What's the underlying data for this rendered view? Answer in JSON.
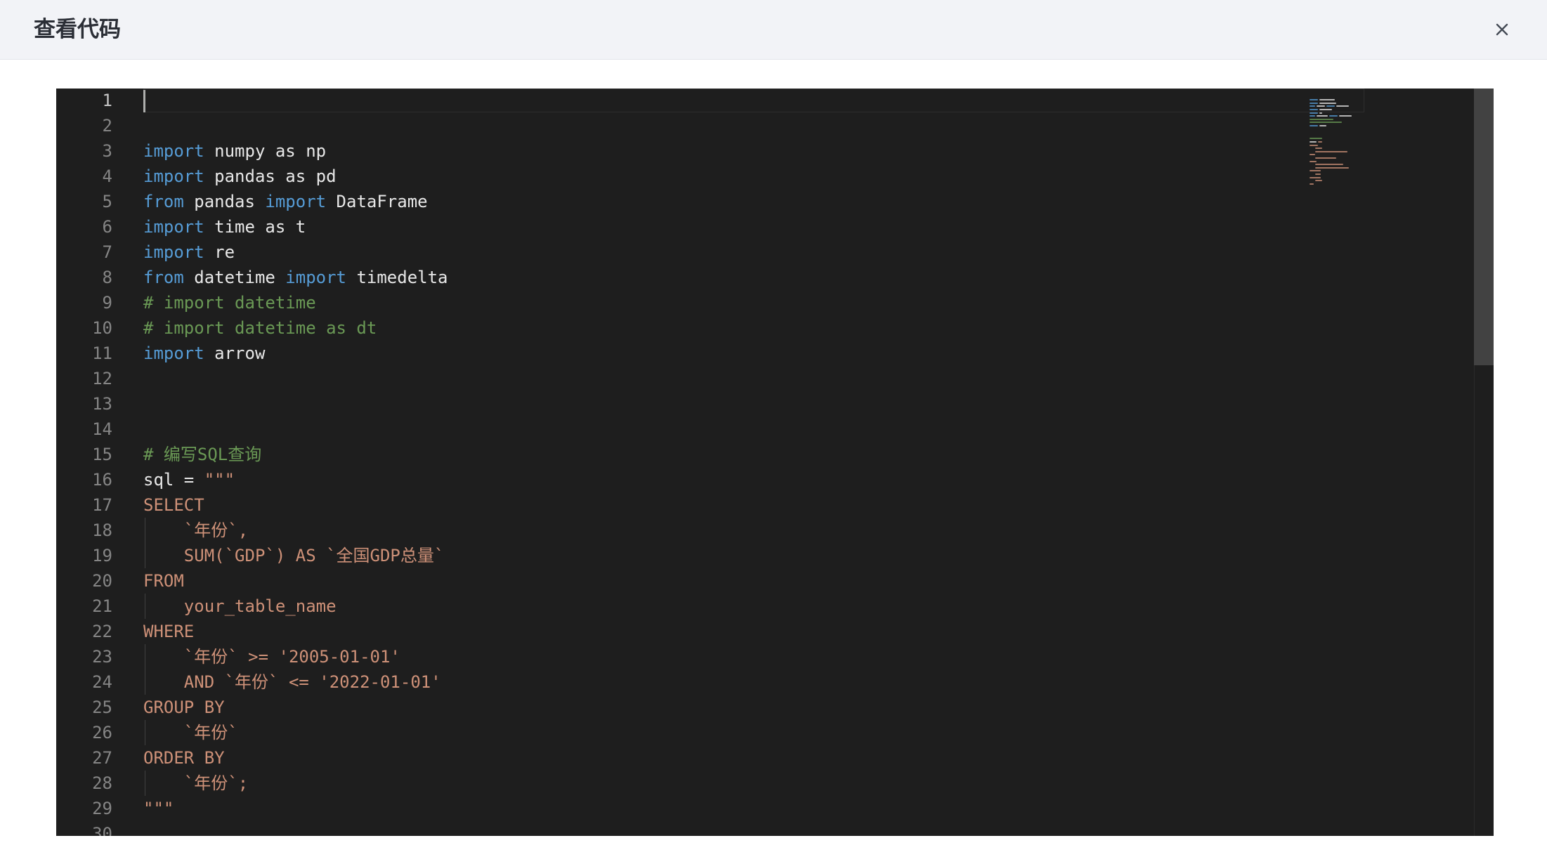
{
  "dialog": {
    "title": "查看代码",
    "close_icon": "close-icon"
  },
  "editor": {
    "line_numbers": [
      "1",
      "2",
      "3",
      "4",
      "5",
      "6",
      "7",
      "8",
      "9",
      "10",
      "11",
      "12",
      "13",
      "14",
      "15",
      "16",
      "17",
      "18",
      "19",
      "20",
      "21",
      "22",
      "23",
      "24",
      "25",
      "26",
      "27",
      "28",
      "29",
      "30"
    ],
    "active_line": 1,
    "lines": [
      [],
      [],
      [
        [
          "kw",
          "import"
        ],
        [
          "id",
          " numpy as np"
        ]
      ],
      [
        [
          "kw",
          "import"
        ],
        [
          "id",
          " pandas as pd"
        ]
      ],
      [
        [
          "kw",
          "from"
        ],
        [
          "id",
          " pandas "
        ],
        [
          "kw",
          "import"
        ],
        [
          "id",
          " DataFrame"
        ]
      ],
      [
        [
          "kw",
          "import"
        ],
        [
          "id",
          " time as t"
        ]
      ],
      [
        [
          "kw",
          "import"
        ],
        [
          "id",
          " re"
        ]
      ],
      [
        [
          "kw",
          "from"
        ],
        [
          "id",
          " datetime "
        ],
        [
          "kw",
          "import"
        ],
        [
          "id",
          " timedelta"
        ]
      ],
      [
        [
          "cm",
          "# import datetime"
        ]
      ],
      [
        [
          "cm",
          "# import datetime as dt"
        ]
      ],
      [
        [
          "kw",
          "import"
        ],
        [
          "id",
          " arrow"
        ]
      ],
      [],
      [],
      [],
      [
        [
          "cm",
          "# 编写SQL查询"
        ]
      ],
      [
        [
          "id",
          "sql = "
        ],
        [
          "st",
          "\"\"\""
        ]
      ],
      [
        [
          "st",
          "SELECT"
        ]
      ],
      [
        [
          "st",
          "    `年份`,"
        ]
      ],
      [
        [
          "st",
          "    SUM(`GDP`) AS `全国GDP总量`"
        ]
      ],
      [
        [
          "st",
          "FROM"
        ]
      ],
      [
        [
          "st",
          "    your_table_name"
        ]
      ],
      [
        [
          "st",
          "WHERE"
        ]
      ],
      [
        [
          "st",
          "    `年份` >= '2005-01-01'"
        ]
      ],
      [
        [
          "st",
          "    AND `年份` <= '2022-01-01'"
        ]
      ],
      [
        [
          "st",
          "GROUP BY"
        ]
      ],
      [
        [
          "st",
          "    `年份`"
        ]
      ],
      [
        [
          "st",
          "ORDER BY"
        ]
      ],
      [
        [
          "st",
          "    `年份`;"
        ]
      ],
      [
        [
          "st",
          "\"\"\""
        ]
      ],
      []
    ]
  },
  "colors": {
    "keyword": "#569cd6",
    "identifier": "#e8e8e8",
    "comment": "#6a9955",
    "string": "#ce9178",
    "editor_bg": "#1e1e1e",
    "header_bg": "#f2f3f7"
  }
}
